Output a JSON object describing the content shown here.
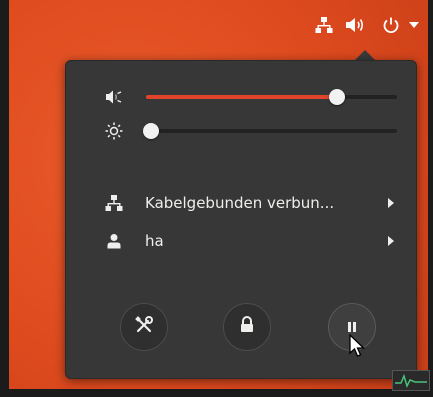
{
  "top_bar": {
    "icons": [
      "network-wired-icon",
      "volume-icon",
      "power-icon",
      "caret-down-icon"
    ]
  },
  "system_menu": {
    "volume": {
      "icon": "speaker-icon",
      "level": 0.76
    },
    "brightness": {
      "icon": "brightness-sun-icon",
      "level": 0.02
    },
    "network": {
      "icon": "network-wired-icon",
      "label": "Kabelgebunden verbun...",
      "has_submenu": true
    },
    "user": {
      "icon": "user-icon",
      "label": "ha",
      "has_submenu": true
    },
    "actions": [
      {
        "name": "settings",
        "icon": "tools-icon"
      },
      {
        "name": "lock",
        "icon": "lock-icon"
      },
      {
        "name": "suspend",
        "icon": "pause-icon"
      }
    ]
  },
  "colors": {
    "accent": "#e0452b",
    "menu_bg": "#373737",
    "text": "#eeeeec",
    "desktop": "#dd4a1e"
  }
}
